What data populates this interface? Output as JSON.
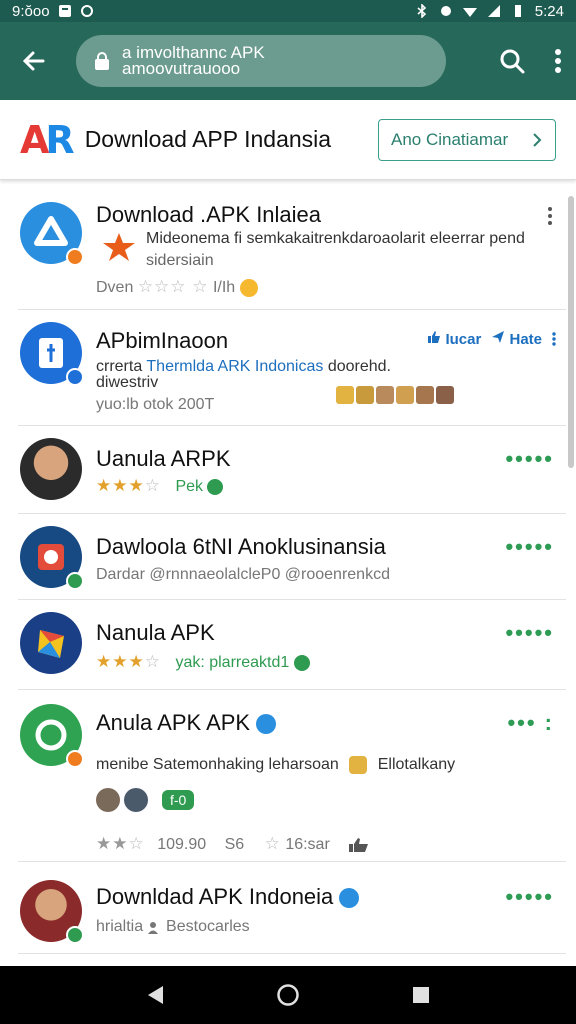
{
  "status_bar": {
    "time_left": "9:ŏoo",
    "time_right": "5:24"
  },
  "url_bar": {
    "line1": "a imvolthannc APK",
    "line2": "amoovutrauooo"
  },
  "header": {
    "title": "Download APP Indansia",
    "language_button": "Ano Cinatiamar"
  },
  "items": [
    {
      "name": "Download .APK Inlaiea",
      "desc1": "Mideonema fi semkakaitrenkdaroaolarit eleerrar pend",
      "desc2": "sidersiain",
      "meta": "Dven",
      "meta2": "I/Ih"
    },
    {
      "name": "APbimInaoon",
      "desc1_a": "crrerta ",
      "desc1_b": "Thermlda ARK Indonicas",
      "desc1_c": " doorehd.",
      "desc2": "diwestriv",
      "meta": "yuo:lb otok 200T",
      "action1": "Iucar",
      "action2": "Hate"
    },
    {
      "name": "Uanula ARPK",
      "tag": "Pek"
    },
    {
      "name": "Dawloola 6tNI Anoklusinansia",
      "sub": "Dardar @rnnnaeolalcleP0 @rooenrenkcd"
    },
    {
      "name": "Nanula APK",
      "tag": "yak: plarreaktd1"
    },
    {
      "name": "Anula APK APK",
      "desc1": "menibe Satemonhaking leharsoan",
      "desc1_b": "Ellotalkany",
      "chip": "f-0",
      "rating_value": "109.90",
      "rating_b": "S6",
      "rating_c": "16:sar"
    },
    {
      "name": "Downldad APK Indoneia",
      "sub": "hrialtia",
      "sub_b": "Bestocarles"
    }
  ],
  "colors": {
    "app_bar": "#26685a",
    "accent": "#2e9c55",
    "star": "#e2a12b"
  }
}
